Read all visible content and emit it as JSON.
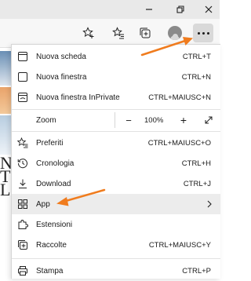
{
  "window_controls": {
    "minimize_icon": "minimize-icon",
    "restore_icon": "restore-icon",
    "close_icon": "close-icon"
  },
  "toolbar": {
    "buttons": [
      "add-favorite-icon",
      "favorites-icon",
      "collections-icon",
      "profile-avatar",
      "more-icon"
    ]
  },
  "background_page": {
    "letters": [
      "N",
      "T",
      "L"
    ]
  },
  "menu": {
    "items": [
      {
        "label": "Nuova scheda",
        "shortcut": "CTRL+T",
        "icon": "new-tab-icon"
      },
      {
        "label": "Nuova finestra",
        "shortcut": "CTRL+N",
        "icon": "new-window-icon"
      },
      {
        "label": "Nuova finestra InPrivate",
        "shortcut": "CTRL+MAIUSC+N",
        "icon": "inprivate-icon"
      },
      {
        "label": "Zoom",
        "value": "100%",
        "icon": ""
      },
      {
        "label": "Preferiti",
        "shortcut": "CTRL+MAIUSC+O",
        "icon": "favorites-icon"
      },
      {
        "label": "Cronologia",
        "shortcut": "CTRL+H",
        "icon": "history-icon"
      },
      {
        "label": "Download",
        "shortcut": "CTRL+J",
        "icon": "download-icon"
      },
      {
        "label": "App",
        "shortcut": "",
        "icon": "apps-icon"
      },
      {
        "label": "Estensioni",
        "shortcut": "",
        "icon": "extensions-icon"
      },
      {
        "label": "Raccolte",
        "shortcut": "CTRL+MAIUSC+Y",
        "icon": "collections-icon"
      },
      {
        "label": "Stampa",
        "shortcut": "CTRL+P",
        "icon": "print-icon"
      }
    ],
    "zoom_minus": "−",
    "zoom_plus": "+"
  },
  "colors": {
    "annotation_arrow": "#f07c1e",
    "hover_background": "#ececec",
    "menu_text": "#1a1a1a"
  }
}
